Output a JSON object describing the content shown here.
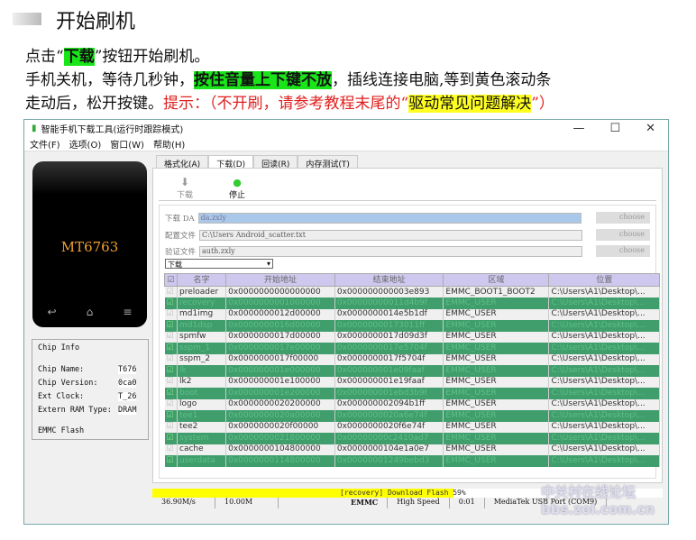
{
  "doc": {
    "heading": "开始刷机",
    "line1_a": "点击“",
    "line1_b": "下载",
    "line1_c": "”按钮开始刷机。",
    "line2_a": "手机关机，等待几秒钟，",
    "line2_b": "按住音量上下键不放",
    "line2_c": "，插线连接电脑,等到黄色滚动条",
    "line3_a": "走动后，松开按键。",
    "line3_b": "提示：（不开刷，请参考教程末尾的“",
    "line3_c": "驱动常见问题解决",
    "line3_d": "”）"
  },
  "window": {
    "title": "智能手机下载工具(运行时跟踪模式)",
    "controls": [
      "—",
      "☐",
      "✕"
    ],
    "menu": [
      "文件(F)",
      "选项(O)",
      "窗口(W)",
      "帮助(H)"
    ],
    "phone_label": "MT6763",
    "chip_info": {
      "title": "Chip Info",
      "rows": [
        {
          "label": "Chip Name:",
          "value": "T676"
        },
        {
          "label": "Chip Version:",
          "value": "0ca0"
        },
        {
          "label": "Ext Clock:",
          "value": "T_26"
        },
        {
          "label": "Extern RAM Type:",
          "value": "DRAM"
        }
      ],
      "flash": "EMMC Flash"
    },
    "tabs": [
      "格式化(A)",
      "下载(D)",
      "回读(R)",
      "内存测试(T)"
    ],
    "toolbar": {
      "download": "下载",
      "stop": "停止"
    },
    "form": {
      "da_label": "下载 DA",
      "da_value": "da.zxly",
      "scatter_label": "配置文件",
      "scatter_value": "C:\\Users                    Android_scatter.txt",
      "auth_label": "验证文件",
      "auth_value": "auth.zxly",
      "choose": "choose",
      "mode": "下载"
    },
    "table": {
      "headers": [
        "名字",
        "开始地址",
        "结束地址",
        "区域",
        "位置"
      ],
      "rows": [
        [
          "preloader",
          "0x0000000000000000",
          "0x000000000003e893",
          "EMMC_BOOT1_BOOT2",
          "C:\\Users\\A1\\Desktop\\..."
        ],
        [
          "recovery",
          "0x0000000001000000",
          "0x00000000011d4b9f",
          "EMMC_USER",
          "C:\\Users\\A1\\Desktop\\..."
        ],
        [
          "md1img",
          "0x0000000012d00000",
          "0x0000000014e5b1df",
          "EMMC_USER",
          "C:\\Users\\A1\\Desktop\\..."
        ],
        [
          "md1dsp",
          "0x0000000016d00000",
          "0x00000000173011ff",
          "EMMC_USER",
          "C:\\Users\\A1\\Desktop\\..."
        ],
        [
          "spmfw",
          "0x0000000017d00000",
          "0x0000000017d09d3f",
          "EMMC_USER",
          "C:\\Users\\A1\\Desktop\\..."
        ],
        [
          "sspm_1",
          "0x0000000017e00000",
          "0x0000000017e5704f",
          "EMMC_USER",
          "C:\\Users\\A1\\Desktop\\..."
        ],
        [
          "sspm_2",
          "0x0000000017f00000",
          "0x0000000017f5704f",
          "EMMC_USER",
          "C:\\Users\\A1\\Desktop\\..."
        ],
        [
          "lk",
          "0x000000001e000000",
          "0x000000001e09faaf",
          "EMMC_USER",
          "C:\\Users\\A1\\Desktop\\..."
        ],
        [
          "lk2",
          "0x000000001e100000",
          "0x000000001e19faaf",
          "EMMC_USER",
          "C:\\Users\\A1\\Desktop\\..."
        ],
        [
          "boot",
          "0x000000001e200000",
          "0x000000001ebd3b9f",
          "EMMC_USER",
          "C:\\Users\\A1\\Desktop\\..."
        ],
        [
          "logo",
          "0x0000000020200000",
          "0x000000002094b1ff",
          "EMMC_USER",
          "C:\\Users\\A1\\Desktop\\..."
        ],
        [
          "tee1",
          "0x0000000020a00000",
          "0x0000000020a6e74f",
          "EMMC_USER",
          "C:\\Users\\A1\\Desktop\\..."
        ],
        [
          "tee2",
          "0x0000000020f00000",
          "0x0000000020f6e74f",
          "EMMC_USER",
          "C:\\Users\\A1\\Desktop\\..."
        ],
        [
          "system",
          "0x0000000021800000",
          "0x00000000c2410ad7",
          "EMMC_USER",
          "C:\\Users\\A1\\Desktop\\..."
        ],
        [
          "cache",
          "0x0000000104800000",
          "0x0000000104e1a0e7",
          "EMMC_USER",
          "C:\\Users\\A1\\Desktop\\..."
        ],
        [
          "userdata",
          "0x0000000114800000",
          "0x00000001249bebd3",
          "EMMC_USER",
          "C:\\Users\\A1\\Desktop\\..."
        ]
      ],
      "highlight_color": "#3f9e6c"
    },
    "progress": {
      "text": "[recovery] Download Flash 59%",
      "percent": 59,
      "color": "#ffff00"
    },
    "status": [
      "36.90M/s",
      "10.00M",
      "EMMC",
      "High Speed",
      "0:01",
      "MediaTek USB Port (COM9)"
    ]
  },
  "watermark": "中关村在线论坛 bbs.zol.com.cn"
}
